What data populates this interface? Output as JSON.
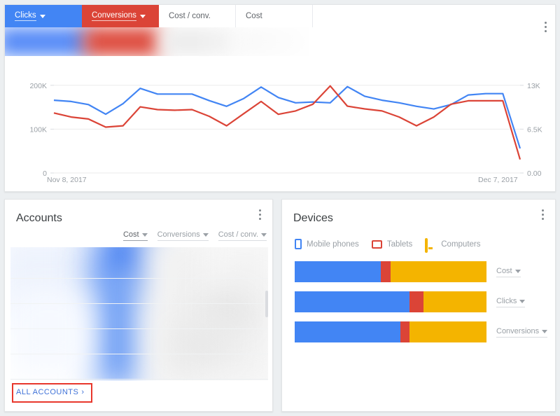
{
  "performance_card": {
    "tabs": [
      {
        "label": "Clicks",
        "style": "blue",
        "has_caret": true,
        "selected": true
      },
      {
        "label": "Conversions",
        "style": "red",
        "has_caret": true,
        "selected": true
      },
      {
        "label": "Cost / conv.",
        "style": "plain",
        "has_caret": false,
        "selected": false
      },
      {
        "label": "Cost",
        "style": "plain",
        "has_caret": false,
        "selected": false
      }
    ],
    "menu_icon": "kebab-menu-icon"
  },
  "chart_data": {
    "type": "line",
    "title": "",
    "xlabel": "",
    "ylabel": "",
    "x_tick_labels": [
      "Nov 8, 2017",
      "Dec 7, 2017"
    ],
    "left_axis": {
      "name": "Clicks",
      "tick_labels": [
        "0",
        "100K",
        "200K"
      ],
      "ticks": [
        0,
        100000,
        200000
      ],
      "ylim": [
        0,
        230000
      ]
    },
    "right_axis": {
      "name": "Conversions",
      "tick_labels": [
        "0.00",
        "6.5K",
        "13K"
      ],
      "ticks": [
        0,
        6500,
        13000
      ],
      "ylim": [
        0,
        14950
      ]
    },
    "grid": true,
    "legend": "none",
    "series": [
      {
        "name": "Clicks",
        "color": "#4285f4",
        "axis": "left",
        "values": [
          166000,
          163000,
          156000,
          134000,
          158000,
          193000,
          180000,
          180000,
          180000,
          165000,
          152000,
          170000,
          196000,
          172000,
          160000,
          162000,
          160000,
          197000,
          175000,
          166000,
          160000,
          152000,
          146000,
          156000,
          178000,
          181000,
          181000,
          56000
        ]
      },
      {
        "name": "Conversions",
        "color": "#db4437",
        "axis": "right",
        "values": [
          8900,
          8300,
          8000,
          6800,
          7000,
          9800,
          9400,
          9300,
          9400,
          8400,
          7000,
          8800,
          10600,
          8700,
          9200,
          10200,
          12900,
          9900,
          9500,
          9200,
          8300,
          7000,
          8300,
          10200,
          10700,
          10700,
          10700,
          2000
        ]
      }
    ]
  },
  "accounts_card": {
    "title": "Accounts",
    "menu_icon": "kebab-menu-icon",
    "metrics": [
      {
        "label": "Cost",
        "selected": true
      },
      {
        "label": "Conversions",
        "selected": false
      },
      {
        "label": "Cost / conv.",
        "selected": false
      }
    ],
    "body_state": "blurred-redacted-content",
    "footer_link": {
      "label": "ALL ACCOUNTS",
      "chevron": "›",
      "highlighted": true
    }
  },
  "devices_card": {
    "title": "Devices",
    "menu_icon": "kebab-menu-icon",
    "legend": [
      {
        "label": "Mobile phones",
        "icon": "mobile-phone-icon",
        "color": "#4285f4"
      },
      {
        "label": "Tablets",
        "icon": "tablet-icon",
        "color": "#db4437"
      },
      {
        "label": "Computers",
        "icon": "computer-icon",
        "color": "#f4b400"
      }
    ],
    "bars": [
      {
        "label": "Cost",
        "mobile_pct": 45,
        "tablet_pct": 5,
        "computer_pct": 50
      },
      {
        "label": "Clicks",
        "mobile_pct": 60,
        "tablet_pct": 7,
        "computer_pct": 33
      },
      {
        "label": "Conversions",
        "mobile_pct": 55,
        "tablet_pct": 5,
        "computer_pct": 40
      }
    ]
  },
  "colors": {
    "blue": "#4285f4",
    "red": "#db4437",
    "yellow": "#f4b400",
    "annotation": "#e8372c",
    "link": "#3f72d8",
    "muted_text": "#9aa0a6"
  }
}
